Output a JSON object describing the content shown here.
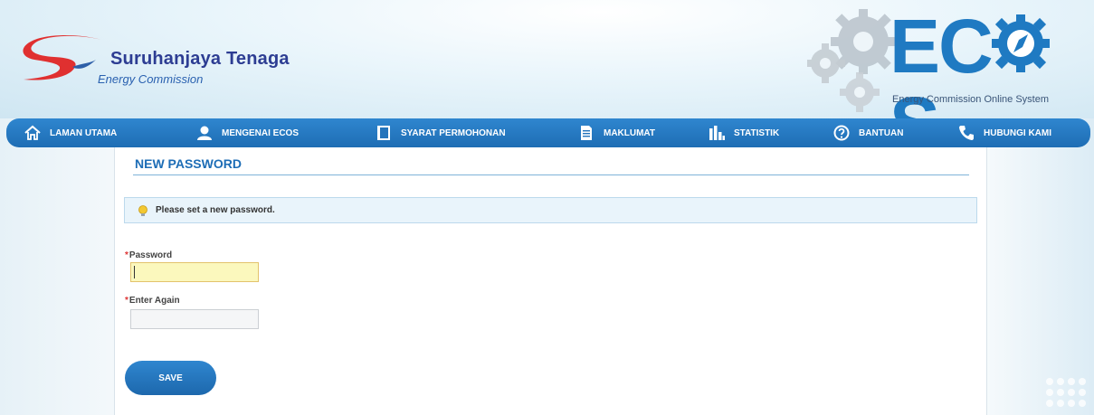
{
  "header": {
    "brand_name": "Suruhanjaya Tenaga",
    "brand_subtitle": "Energy Commission",
    "system_logo_text": "EC",
    "system_logo_end": "S",
    "system_subtitle": "Energy Commission Online System"
  },
  "nav": {
    "items": [
      {
        "label": "LAMAN UTAMA",
        "icon": "home-icon"
      },
      {
        "label": "MENGENAI ECOS",
        "icon": "user-icon"
      },
      {
        "label": "SYARAT PERMOHONAN",
        "icon": "book-icon"
      },
      {
        "label": "MAKLUMAT",
        "icon": "document-icon"
      },
      {
        "label": "STATISTIK",
        "icon": "bar-chart-icon"
      },
      {
        "label": "BANTUAN",
        "icon": "help-icon"
      },
      {
        "label": "HUBUNGI KAMI",
        "icon": "phone-icon"
      }
    ]
  },
  "page": {
    "title": "NEW PASSWORD",
    "info_message": "Please set a new password.",
    "info_icon": "lightbulb-icon",
    "required_mark": "*",
    "fields": {
      "password_label": "Password",
      "password_value": "",
      "confirm_label": "Enter Again",
      "confirm_value": ""
    },
    "save_label": "SAVE"
  },
  "colors": {
    "nav_blue": "#1e6db4",
    "title_blue": "#1d6db6",
    "brand_navy": "#2d3d93",
    "logo_blue": "#1f7ac2",
    "swoosh_red": "#e03030",
    "focused_input": "#fbf8bd"
  }
}
